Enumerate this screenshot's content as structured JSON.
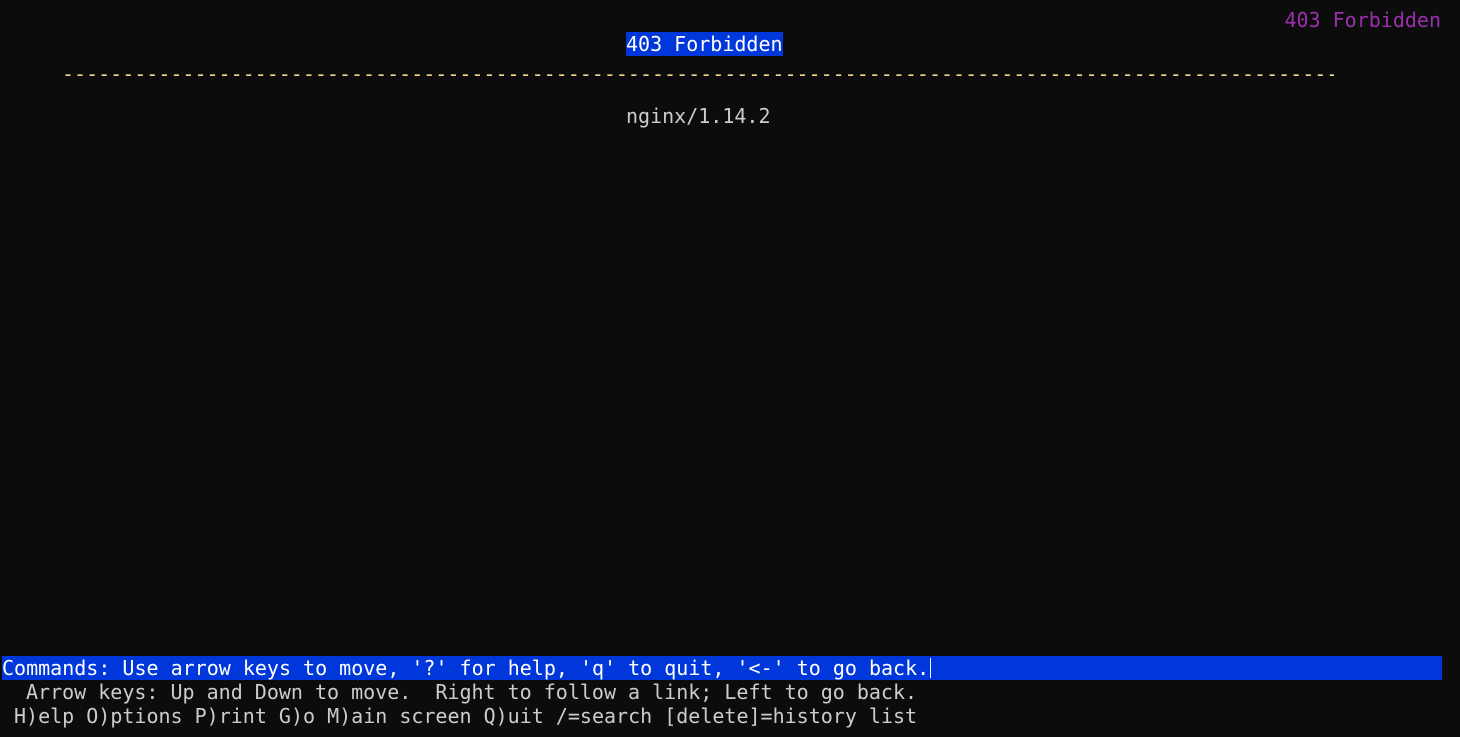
{
  "window": {
    "title": "403 Forbidden"
  },
  "page": {
    "heading": "403 Forbidden",
    "rule": "-----------------------------------------------------------------------------------------------------------",
    "server_signature": "nginx/1.14.2"
  },
  "statusbar": {
    "commands_text": "Commands: Use arrow keys to move, '?' for help, 'q' to quit, '<-' to go back."
  },
  "help": {
    "line1": "Arrow keys: Up and Down to move.  Right to follow a link; Left to go back.",
    "line2": "H)elp O)ptions P)rint G)o M)ain screen Q)uit /=search [delete]=history list"
  },
  "colors": {
    "background": "#0c0c0c",
    "highlight": "#0037da",
    "title": "#9b2fae",
    "rule": "#f0d58c",
    "text": "#cccccc"
  }
}
